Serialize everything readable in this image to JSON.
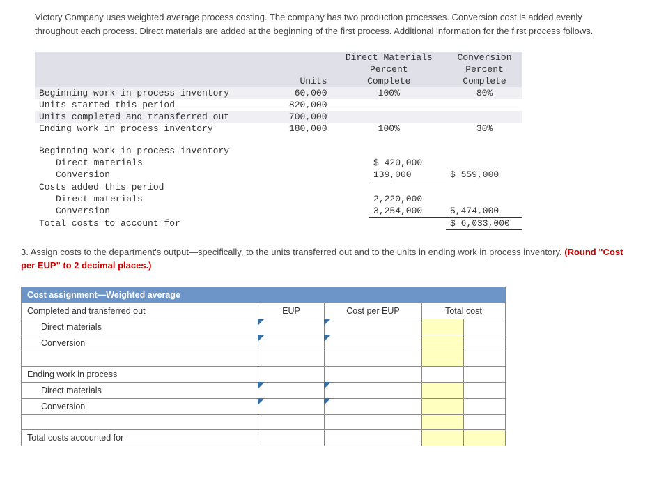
{
  "intro": "Victory Company uses weighted average process costing. The company has two production processes. Conversion cost is added evenly throughout each process. Direct materials are added at the beginning of the first process. Additional information for the first process follows.",
  "col_headers": {
    "units": "Units",
    "dm": "Direct Materials",
    "dm_pct": "Percent Complete",
    "conv": "Conversion",
    "conv_pct": "Percent Complete"
  },
  "units_rows": {
    "r1": {
      "label": "Beginning work in process inventory",
      "units": "60,000",
      "dm": "100%",
      "conv": "80%"
    },
    "r2": {
      "label": "Units started this period",
      "units": "820,000",
      "dm": "",
      "conv": ""
    },
    "r3": {
      "label": "Units completed and transferred out",
      "units": "700,000",
      "dm": "",
      "conv": ""
    },
    "r4": {
      "label": "Ending work in process inventory",
      "units": "180,000",
      "dm": "100%",
      "conv": "30%"
    }
  },
  "cost_rows": {
    "bwip_label": "Beginning work in process inventory",
    "bwip_dm_label": "Direct materials",
    "bwip_dm_amt": "$ 420,000",
    "bwip_conv_label": "Conversion",
    "bwip_conv_amt": "139,000",
    "bwip_total": "$ 559,000",
    "added_label": "Costs added this period",
    "added_dm_label": "Direct materials",
    "added_dm_amt": "2,220,000",
    "added_conv_label": "Conversion",
    "added_conv_amt": "3,254,000",
    "added_total": "5,474,000",
    "total_label": "Total costs to account for",
    "grand_total": "$ 6,033,000"
  },
  "question": {
    "text": "3. Assign costs to the department's output—specifically, to the units transferred out and to the units in ending work in process inventory. ",
    "red": "(Round \"Cost per EUP\" to 2 decimal places.)"
  },
  "answer": {
    "title": "Cost assignment—Weighted average",
    "cto": "Completed and transferred out",
    "hdr_eup": "EUP",
    "hdr_cpe": "Cost per EUP",
    "hdr_tc": "Total cost",
    "dm": "Direct materials",
    "conv": "Conversion",
    "ewip": "Ending work in process",
    "total": "Total costs accounted for"
  }
}
